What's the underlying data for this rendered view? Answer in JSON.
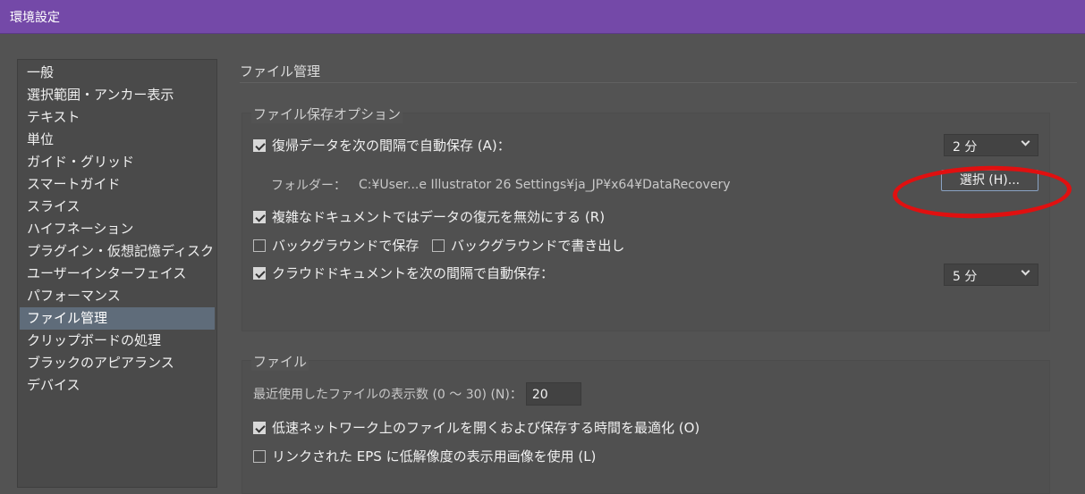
{
  "window": {
    "title": "環境設定"
  },
  "sidebar": {
    "items": [
      {
        "label": "一般"
      },
      {
        "label": "選択範囲・アンカー表示"
      },
      {
        "label": "テキスト"
      },
      {
        "label": "単位"
      },
      {
        "label": "ガイド・グリッド"
      },
      {
        "label": "スマートガイド"
      },
      {
        "label": "スライス"
      },
      {
        "label": "ハイフネーション"
      },
      {
        "label": "プラグイン・仮想記憶ディスク"
      },
      {
        "label": "ユーザーインターフェイス"
      },
      {
        "label": "パフォーマンス"
      },
      {
        "label": "ファイル管理",
        "selected": true
      },
      {
        "label": "クリップボードの処理"
      },
      {
        "label": "ブラックのアピアランス"
      },
      {
        "label": "デバイス"
      }
    ]
  },
  "main": {
    "title": "ファイル管理",
    "save_options": {
      "title": "ファイル保存オプション",
      "autosave": {
        "label": "復帰データを次の間隔で自動保存 (A)：",
        "checked": true,
        "value": "2 分"
      },
      "folder": {
        "label": "フォルダー：",
        "path": "C:¥User...e Illustrator 26 Settings¥ja_JP¥x64¥DataRecovery",
        "button": "選択 (H)..."
      },
      "disable_complex": {
        "label": "複雑なドキュメントではデータの復元を無効にする (R)",
        "checked": true
      },
      "bg_save": {
        "label": "バックグラウンドで保存",
        "checked": false
      },
      "bg_export": {
        "label": "バックグラウンドで書き出し",
        "checked": false
      },
      "cloud_autosave": {
        "label": "クラウドドキュメントを次の間隔で自動保存：",
        "checked": true,
        "value": "5 分"
      }
    },
    "files": {
      "title": "ファイル",
      "recent": {
        "label": "最近使用したファイルの表示数 (0 〜 30) (N)：",
        "value": "20"
      },
      "optimize": {
        "label": "低速ネットワーク上のファイルを開くおよび保存する時間を最適化 (O)",
        "checked": true
      },
      "low_res_eps": {
        "label": "リンクされた EPS に低解像度の表示用画像を使用 (L)",
        "checked": false
      }
    }
  },
  "colors": {
    "titlebar": "#7449a8",
    "background": "#535353",
    "selected_item": "#5f6c7a",
    "annotation": "#e01010"
  }
}
